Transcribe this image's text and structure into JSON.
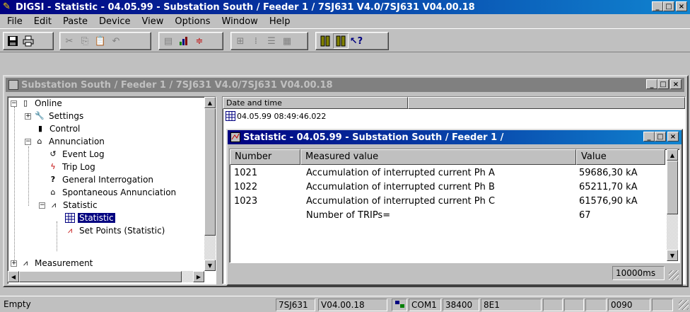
{
  "app": {
    "title": "DIGSI - Statistic - 04.05.99 - Substation South / Feeder 1 / 7SJ631 V4.0/7SJ631 V04.00.18",
    "window_buttons": [
      "_",
      "□",
      "×"
    ]
  },
  "menu": [
    "File",
    "Edit",
    "Paste",
    "Device",
    "View",
    "Options",
    "Window",
    "Help"
  ],
  "toolbar": {
    "icons": [
      "save-icon",
      "print-icon",
      "cut-icon",
      "copy-icon",
      "paste-icon",
      "undo-icon",
      "properties-icon",
      "chart-icon",
      "split-icon",
      "large-icons-icon",
      "small-icons-icon",
      "list-icon",
      "details-icon",
      "device-icon",
      "device-pressed-icon",
      "help-pointer-icon"
    ]
  },
  "child": {
    "title": "Substation South / Feeder 1 / 7SJ631 V4.0/7SJ631 V04.00.18"
  },
  "tree": [
    {
      "label": "Online",
      "expander": "−",
      "level": 0,
      "icon": "device-icon"
    },
    {
      "label": "Settings",
      "expander": "+",
      "level": 1,
      "icon": "settings-icon"
    },
    {
      "label": "Control",
      "expander": "",
      "level": 1,
      "icon": "control-icon"
    },
    {
      "label": "Annunciation",
      "expander": "−",
      "level": 1,
      "icon": "annunciation-icon"
    },
    {
      "label": "Event Log",
      "expander": "",
      "level": 2,
      "icon": "event-log-icon"
    },
    {
      "label": "Trip Log",
      "expander": "",
      "level": 2,
      "icon": "trip-log-icon"
    },
    {
      "label": "General Interrogation",
      "expander": "",
      "level": 2,
      "icon": "general-interrogation-icon"
    },
    {
      "label": "Spontaneous Annunciation",
      "expander": "",
      "level": 2,
      "icon": "spontaneous-icon"
    },
    {
      "label": "Statistic",
      "expander": "−",
      "level": 2,
      "icon": "statistic-folder-icon"
    },
    {
      "label": "Statistic",
      "expander": "",
      "level": 3,
      "icon": "grid-icon",
      "selected": true
    },
    {
      "label": "Set Points (Statistic)",
      "expander": "",
      "level": 3,
      "icon": "set-points-icon"
    },
    {
      "label": "Measurement",
      "expander": "+",
      "level": 1,
      "icon": "measurement-icon"
    }
  ],
  "list": {
    "header": "Date and time",
    "row": "04.05.99  08:49:46.022"
  },
  "statistic": {
    "title": "Statistic - 04.05.99 - Substation South / Feeder 1 /",
    "columns": [
      "Number",
      "Measured value",
      "Value"
    ],
    "rows": [
      {
        "number": "1021",
        "measured": "Accumulation of interrupted current Ph A",
        "value": "59686,30 kA"
      },
      {
        "number": "1022",
        "measured": "Accumulation of interrupted current Ph B",
        "value": "65211,70 kA"
      },
      {
        "number": "1023",
        "measured": "Accumulation of interrupted current Ph C",
        "value": "61576,90 kA"
      },
      {
        "number": "",
        "measured": "Number of TRIPs=",
        "value": "67"
      }
    ],
    "refresh": "10000ms"
  },
  "status": {
    "text": "Empty",
    "device": "7SJ631",
    "version": "V04.00.18",
    "port": "COM1",
    "baud": "38400",
    "format": "8E1",
    "code": "0090"
  }
}
